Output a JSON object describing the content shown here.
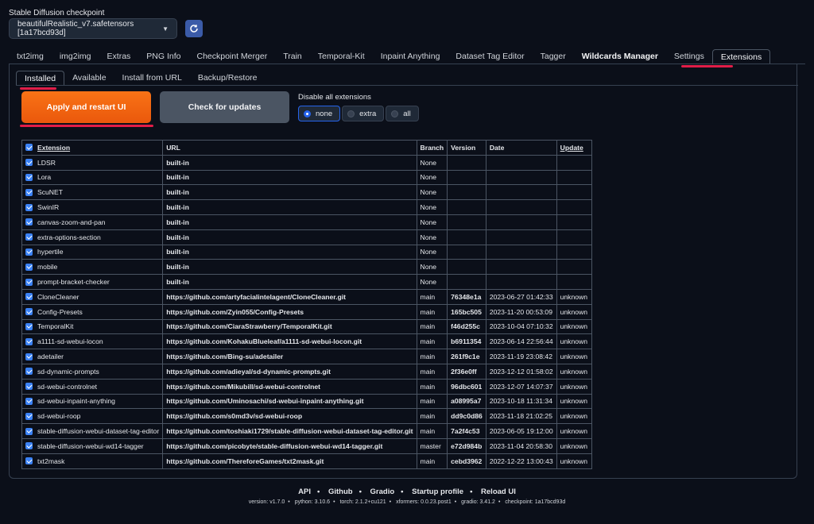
{
  "checkpoint": {
    "label": "Stable Diffusion checkpoint",
    "value": "beautifulRealistic_v7.safetensors [1a17bcd93d]"
  },
  "main_tabs": [
    "txt2img",
    "img2img",
    "Extras",
    "PNG Info",
    "Checkpoint Merger",
    "Train",
    "Temporal-Kit",
    "Inpaint Anything",
    "Dataset Tag Editor",
    "Tagger",
    "Wildcards Manager",
    "Settings",
    "Extensions"
  ],
  "sub_tabs": [
    "Installed",
    "Available",
    "Install from URL",
    "Backup/Restore"
  ],
  "buttons": {
    "apply": "Apply and restart UI",
    "check": "Check for updates"
  },
  "disable": {
    "label": "Disable all extensions",
    "options": [
      "none",
      "extra",
      "all"
    ],
    "selected": "none"
  },
  "table": {
    "headers": [
      "Extension",
      "URL",
      "Branch",
      "Version",
      "Date",
      "Update"
    ],
    "rows": [
      {
        "name": "LDSR",
        "url": "built-in",
        "branch": "None",
        "version": "",
        "date": "",
        "update": ""
      },
      {
        "name": "Lora",
        "url": "built-in",
        "branch": "None",
        "version": "",
        "date": "",
        "update": ""
      },
      {
        "name": "ScuNET",
        "url": "built-in",
        "branch": "None",
        "version": "",
        "date": "",
        "update": ""
      },
      {
        "name": "SwinIR",
        "url": "built-in",
        "branch": "None",
        "version": "",
        "date": "",
        "update": ""
      },
      {
        "name": "canvas-zoom-and-pan",
        "url": "built-in",
        "branch": "None",
        "version": "",
        "date": "",
        "update": ""
      },
      {
        "name": "extra-options-section",
        "url": "built-in",
        "branch": "None",
        "version": "",
        "date": "",
        "update": ""
      },
      {
        "name": "hypertile",
        "url": "built-in",
        "branch": "None",
        "version": "",
        "date": "",
        "update": ""
      },
      {
        "name": "mobile",
        "url": "built-in",
        "branch": "None",
        "version": "",
        "date": "",
        "update": ""
      },
      {
        "name": "prompt-bracket-checker",
        "url": "built-in",
        "branch": "None",
        "version": "",
        "date": "",
        "update": ""
      },
      {
        "name": "CloneCleaner",
        "url": "https://github.com/artyfacialintelagent/CloneCleaner.git",
        "branch": "main",
        "version": "76348e1a",
        "date": "2023-06-27 01:42:33",
        "update": "unknown"
      },
      {
        "name": "Config-Presets",
        "url": "https://github.com/Zyin055/Config-Presets",
        "branch": "main",
        "version": "165bc505",
        "date": "2023-11-20 00:53:09",
        "update": "unknown"
      },
      {
        "name": "TemporalKit",
        "url": "https://github.com/CiaraStrawberry/TemporalKit.git",
        "branch": "main",
        "version": "f46d255c",
        "date": "2023-10-04 07:10:32",
        "update": "unknown"
      },
      {
        "name": "a1111-sd-webui-locon",
        "url": "https://github.com/KohakuBlueleaf/a1111-sd-webui-locon.git",
        "branch": "main",
        "version": "b6911354",
        "date": "2023-06-14 22:56:44",
        "update": "unknown"
      },
      {
        "name": "adetailer",
        "url": "https://github.com/Bing-su/adetailer",
        "branch": "main",
        "version": "261f9c1e",
        "date": "2023-11-19 23:08:42",
        "update": "unknown"
      },
      {
        "name": "sd-dynamic-prompts",
        "url": "https://github.com/adieyal/sd-dynamic-prompts.git",
        "branch": "main",
        "version": "2f36e0ff",
        "date": "2023-12-12 01:58:02",
        "update": "unknown"
      },
      {
        "name": "sd-webui-controlnet",
        "url": "https://github.com/Mikubill/sd-webui-controlnet",
        "branch": "main",
        "version": "96dbc601",
        "date": "2023-12-07 14:07:37",
        "update": "unknown"
      },
      {
        "name": "sd-webui-inpaint-anything",
        "url": "https://github.com/Uminosachi/sd-webui-inpaint-anything.git",
        "branch": "main",
        "version": "a08995a7",
        "date": "2023-10-18 11:31:34",
        "update": "unknown"
      },
      {
        "name": "sd-webui-roop",
        "url": "https://github.com/s0md3v/sd-webui-roop",
        "branch": "main",
        "version": "dd9c0d86",
        "date": "2023-11-18 21:02:25",
        "update": "unknown"
      },
      {
        "name": "stable-diffusion-webui-dataset-tag-editor",
        "url": "https://github.com/toshiaki1729/stable-diffusion-webui-dataset-tag-editor.git",
        "branch": "main",
        "version": "7a2f4c53",
        "date": "2023-06-05 19:12:00",
        "update": "unknown"
      },
      {
        "name": "stable-diffusion-webui-wd14-tagger",
        "url": "https://github.com/picobyte/stable-diffusion-webui-wd14-tagger.git",
        "branch": "master",
        "version": "e72d984b",
        "date": "2023-11-04 20:58:30",
        "update": "unknown"
      },
      {
        "name": "txt2mask",
        "url": "https://github.com/ThereforeGames/txt2mask.git",
        "branch": "main",
        "version": "cebd3962",
        "date": "2022-12-22 13:00:43",
        "update": "unknown"
      }
    ]
  },
  "footer": {
    "links": [
      "API",
      "Github",
      "Gradio",
      "Startup profile",
      "Reload UI"
    ],
    "version_info": [
      "version: v1.7.0",
      "python: 3.10.6",
      "torch: 2.1.2+cu121",
      "xformers: 0.0.23.post1",
      "gradio: 3.41.2",
      "checkpoint: 1a17bcd93d"
    ]
  },
  "colors": {
    "background": "#0b0f19",
    "accent_orange": "#f97316",
    "highlight_red": "#e11d48",
    "checkbox_blue": "#3b82f6"
  }
}
